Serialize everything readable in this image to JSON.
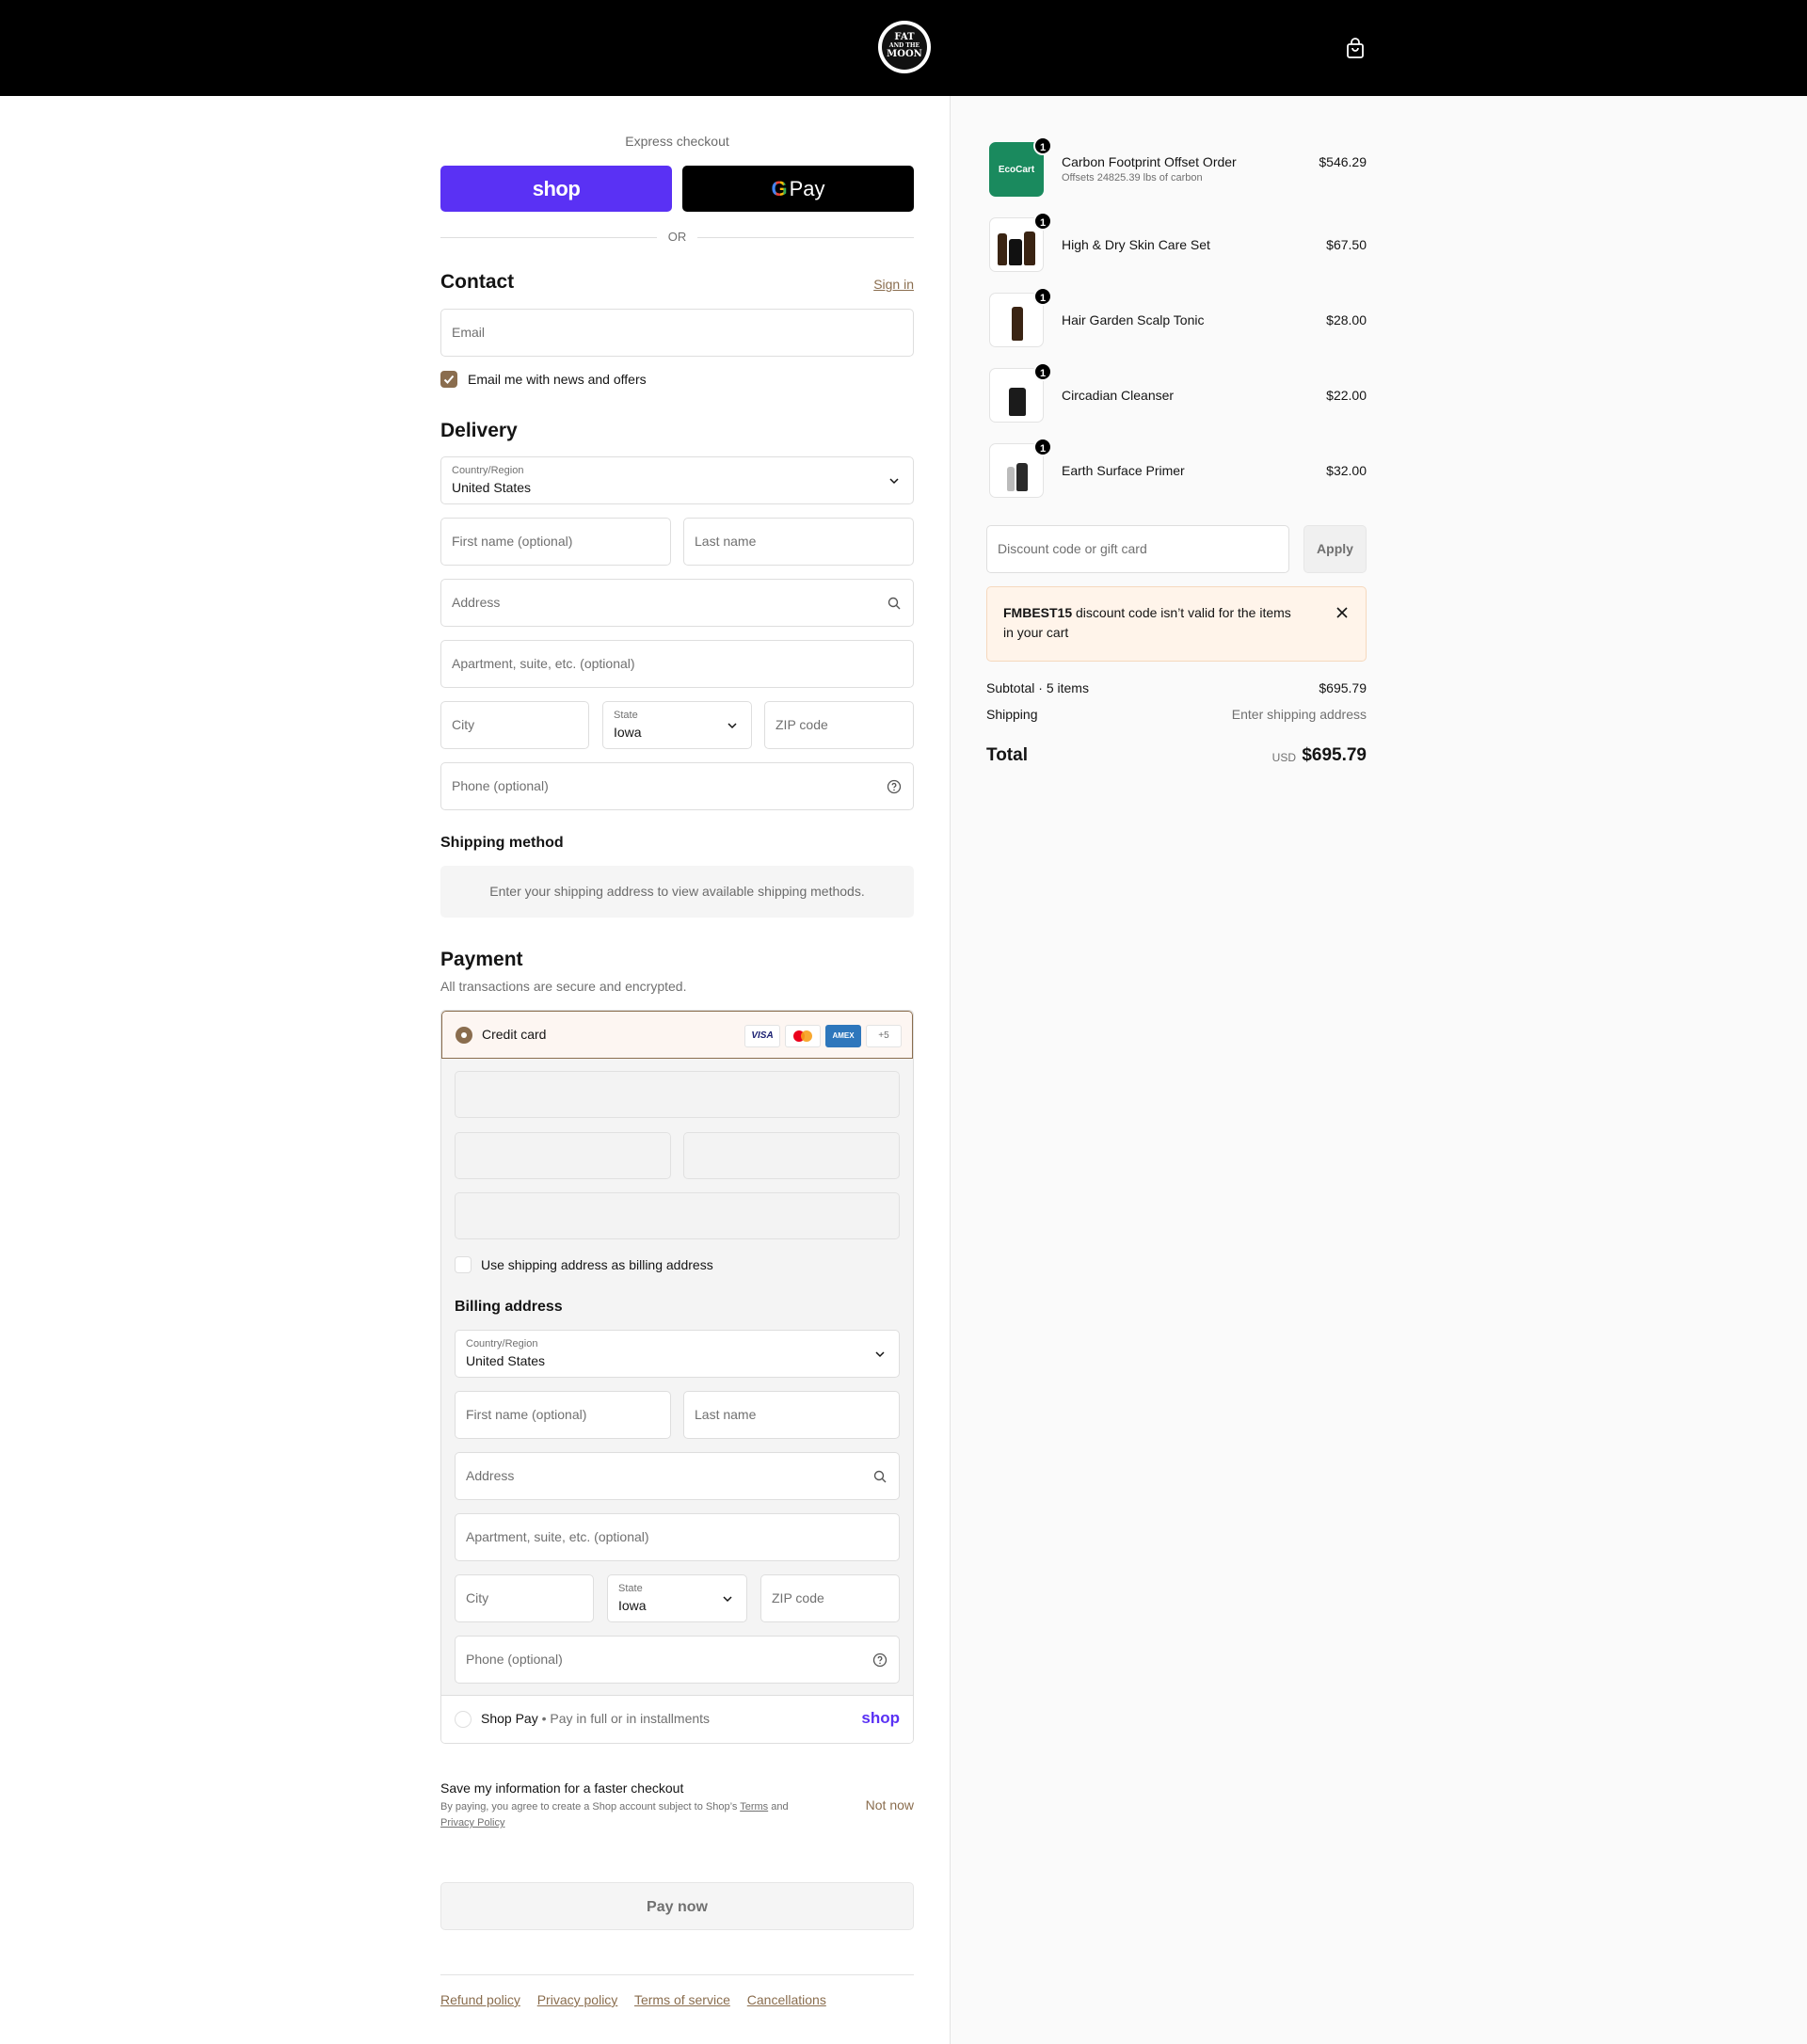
{
  "colors": {
    "accent": "#8a6d4e",
    "shop_purple": "#5a31f4",
    "eco_green": "#1a8a5e",
    "alert_bg": "#fff4ea"
  },
  "header": {
    "logo_top": "FAT",
    "logo_mid": "AND THE",
    "logo_bottom": "MOON",
    "cart_icon": "shopping-bag-icon"
  },
  "express": {
    "label": "Express checkout",
    "shop_label": "shop",
    "gpay_label": "Pay",
    "or_label": "OR"
  },
  "contact": {
    "title": "Contact",
    "sign_in": "Sign in",
    "email_placeholder": "Email",
    "newsletter_label": "Email me with news and offers",
    "newsletter_checked": true
  },
  "delivery": {
    "title": "Delivery",
    "country_label": "Country/Region",
    "country_value": "United States",
    "first_name": "First name (optional)",
    "last_name": "Last name",
    "address": "Address",
    "apartment": "Apartment, suite, etc. (optional)",
    "city": "City",
    "state_label": "State",
    "state_value": "Iowa",
    "zip": "ZIP code",
    "phone": "Phone (optional)"
  },
  "shipping_method": {
    "title": "Shipping method",
    "message": "Enter your shipping address to view available shipping methods."
  },
  "payment": {
    "title": "Payment",
    "description": "All transactions are secure and encrypted.",
    "credit_card_label": "Credit card",
    "card_logos": [
      "VISA",
      "",
      "AMEX",
      "+5"
    ],
    "use_shipping_label": "Use shipping address as billing address",
    "billing": {
      "title": "Billing address",
      "country_label": "Country/Region",
      "country_value": "United States",
      "first_name": "First name (optional)",
      "last_name": "Last name",
      "address": "Address",
      "apartment": "Apartment, suite, etc. (optional)",
      "city": "City",
      "state_label": "State",
      "state_value": "Iowa",
      "zip": "ZIP code",
      "phone": "Phone (optional)"
    },
    "shop_pay_label": "Shop Pay",
    "shop_pay_desc": "Pay in full or in installments",
    "shop_pay_logo": "shop"
  },
  "save_info": {
    "title": "Save my information for a faster checkout",
    "desc_prefix": "By paying, you agree to create a Shop account subject to Shop’s",
    "terms": "Terms",
    "and": "and",
    "privacy": "Privacy Policy",
    "not_now": "Not now"
  },
  "pay_now": "Pay now",
  "footer": {
    "links": [
      "Refund policy",
      "Privacy policy",
      "Terms of service",
      "Cancellations"
    ]
  },
  "cart": {
    "items": [
      {
        "name": "Carbon Footprint Offset Order",
        "sub": "Offsets 24825.39 lbs of carbon",
        "price": "$546.29",
        "qty": "1",
        "thumb_text": "EcoCart"
      },
      {
        "name": "High & Dry Skin Care Set",
        "price": "$67.50",
        "qty": "1"
      },
      {
        "name": "Hair Garden Scalp Tonic",
        "price": "$28.00",
        "qty": "1"
      },
      {
        "name": "Circadian Cleanser",
        "price": "$22.00",
        "qty": "1"
      },
      {
        "name": "Earth Surface Primer",
        "price": "$32.00",
        "qty": "1"
      }
    ],
    "discount_placeholder": "Discount code or gift card",
    "apply": "Apply",
    "alert_code": "FMBEST15",
    "alert_text": "discount code isn’t valid for the items in your cart",
    "subtotal_label": "Subtotal · 5 items",
    "subtotal_value": "$695.79",
    "shipping_label": "Shipping",
    "shipping_value": "Enter shipping address",
    "total_label": "Total",
    "currency": "USD",
    "total_value": "$695.79"
  }
}
